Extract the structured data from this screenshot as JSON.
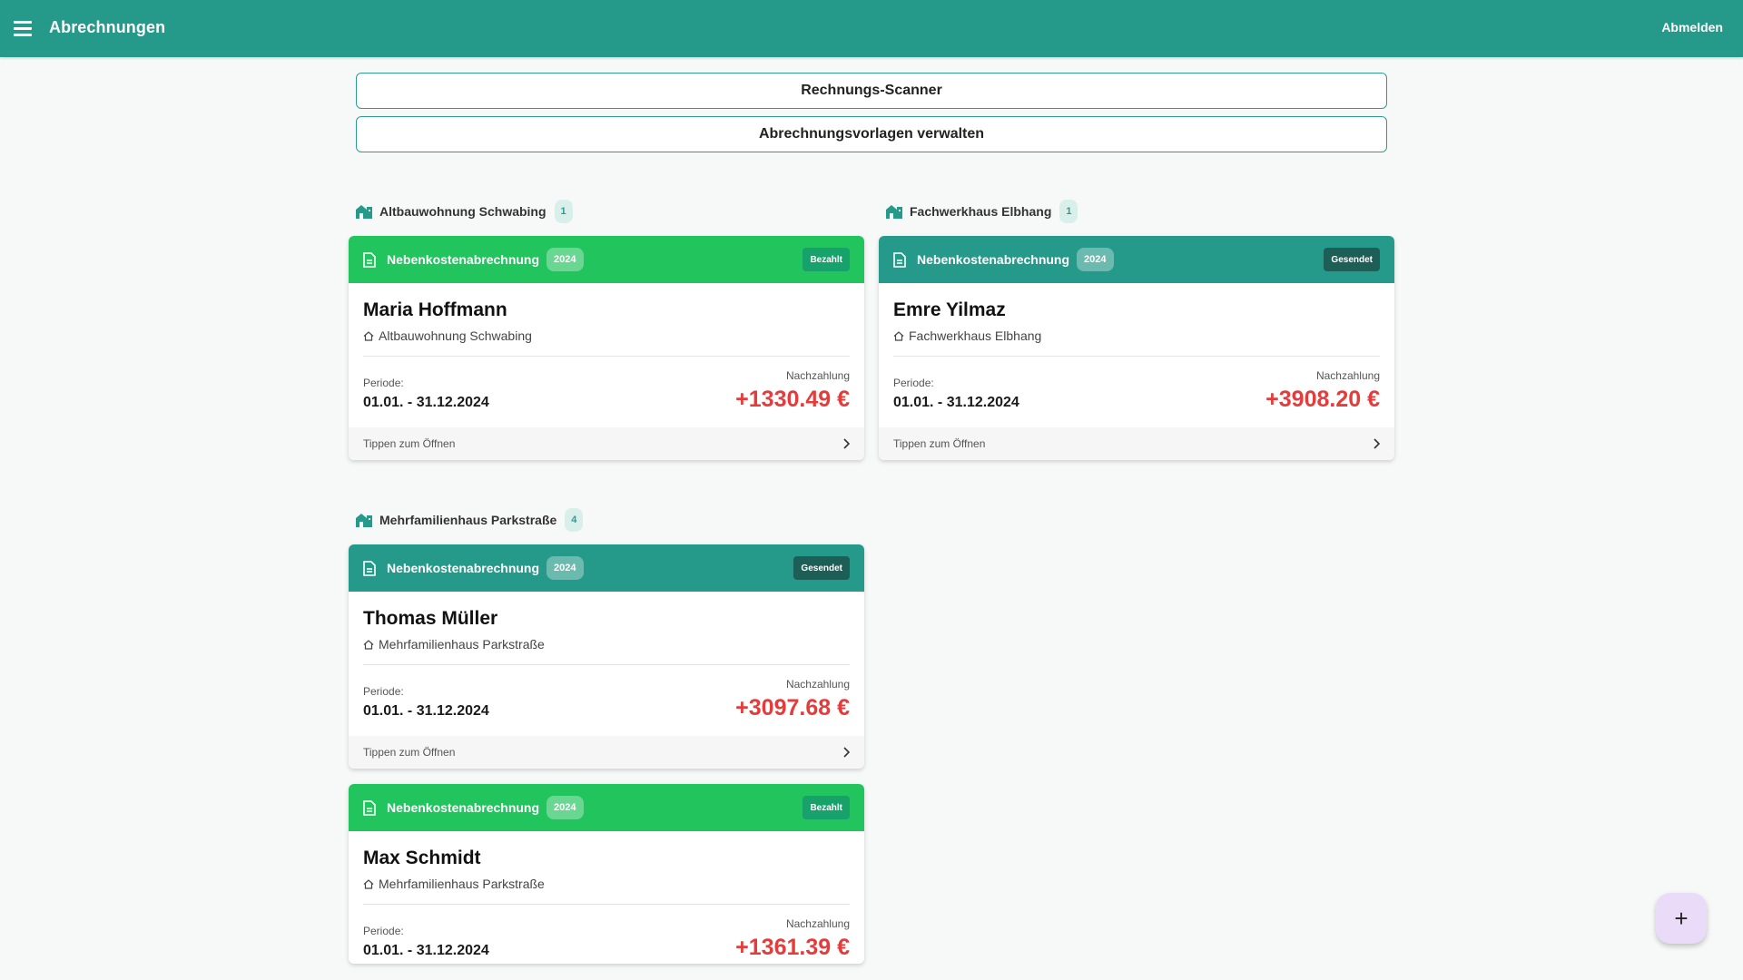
{
  "header": {
    "title": "Abrechnungen",
    "logout_label": "Abmelden"
  },
  "actions": {
    "scanner_label": "Rechnungs-Scanner",
    "templates_label": "Abrechnungsvorlagen verwalten"
  },
  "groups": [
    {
      "name": "Altbauwohnung Schwabing",
      "count": "1",
      "cards": [
        {
          "type": "Nebenkostenabrechnung",
          "year": "2024",
          "status": "Bezahlt",
          "tenant": "Maria Hoffmann",
          "property": "Altbauwohnung Schwabing",
          "period_label": "Periode:",
          "period": "01.01. - 31.12.2024",
          "amount_label": "Nachzahlung",
          "amount": "+1330.49 €",
          "footer": "Tippen zum Öffnen"
        }
      ]
    },
    {
      "name": "Fachwerkhaus Elbhang",
      "count": "1",
      "cards": [
        {
          "type": "Nebenkostenabrechnung",
          "year": "2024",
          "status": "Gesendet",
          "tenant": "Emre Yilmaz",
          "property": "Fachwerkhaus Elbhang",
          "period_label": "Periode:",
          "period": "01.01. - 31.12.2024",
          "amount_label": "Nachzahlung",
          "amount": "+3908.20 €",
          "footer": "Tippen zum Öffnen"
        }
      ]
    },
    {
      "name": "Mehrfamilienhaus Parkstraße",
      "count": "4",
      "cards": [
        {
          "type": "Nebenkostenabrechnung",
          "year": "2024",
          "status": "Gesendet",
          "tenant": "Thomas Müller",
          "property": "Mehrfamilienhaus Parkstraße",
          "period_label": "Periode:",
          "period": "01.01. - 31.12.2024",
          "amount_label": "Nachzahlung",
          "amount": "+3097.68 €",
          "footer": "Tippen zum Öffnen"
        },
        {
          "type": "Nebenkostenabrechnung",
          "year": "2024",
          "status": "Bezahlt",
          "tenant": "Max Schmidt",
          "property": "Mehrfamilienhaus Parkstraße",
          "period_label": "Periode:",
          "period": "01.01. - 31.12.2024",
          "amount_label": "Nachzahlung",
          "amount": "+1361.39 €"
        }
      ]
    }
  ],
  "fab": {
    "icon": "plus-icon",
    "symbol": "+"
  },
  "colors": {
    "primary": "#269a8a",
    "paid": "#22c45e",
    "amount": "#e53b3b",
    "fab": "#eadcf8"
  }
}
